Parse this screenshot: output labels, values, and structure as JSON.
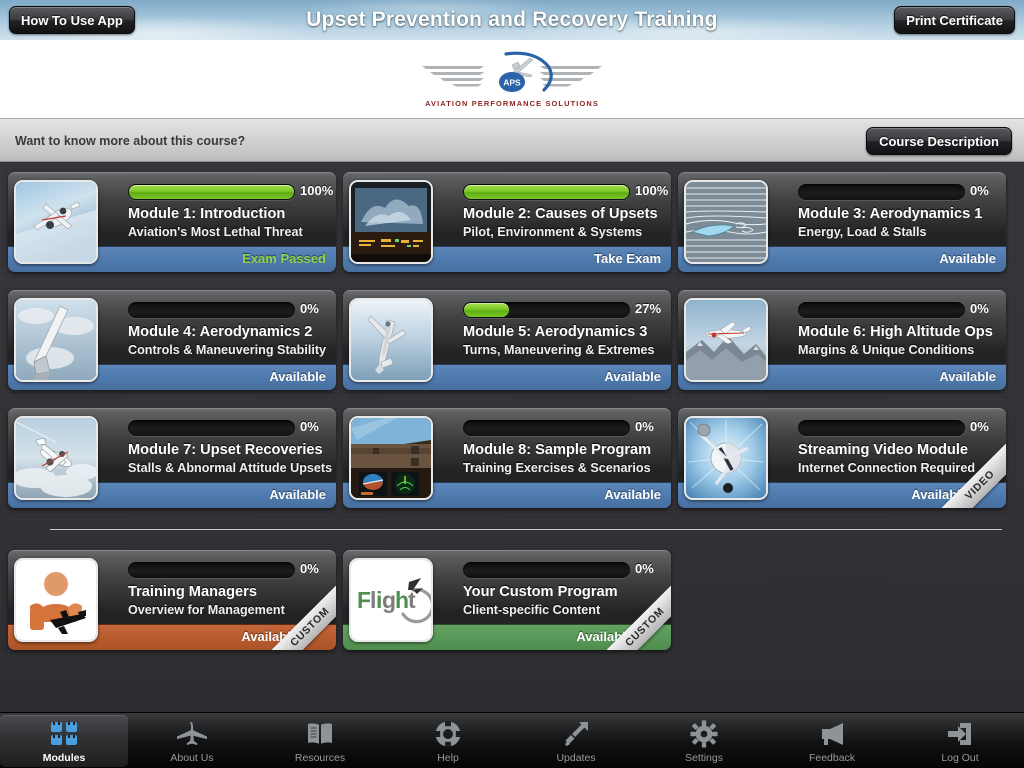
{
  "header": {
    "title": "Upset Prevention and Recovery Training",
    "how_to_button": "How To Use App",
    "print_button": "Print Certificate"
  },
  "logo": {
    "brand": "APS",
    "tagline": "AVIATION PERFORMANCE SOLUTIONS"
  },
  "course_bar": {
    "question": "Want to know more about this course?",
    "button": "Course Description"
  },
  "colors": {
    "progress_green": "#7cc72a",
    "footer_blue": "#4f7aae",
    "footer_orange": "#b85c2f",
    "footer_green": "#589858",
    "passed_text": "#8fd44a",
    "tagline_red": "#8e2420"
  },
  "modules": [
    {
      "title": "Module 1: Introduction",
      "subtitle": "Aviation's Most Lethal Threat",
      "percent_label": "100%",
      "percent": 100,
      "status": "Exam Passed",
      "status_style": "passed",
      "footer_style": "blue",
      "thumb": "airliner-descending-icon",
      "ribbon": null
    },
    {
      "title": "Module 2: Causes of Upsets",
      "subtitle": "Pilot, Environment & Systems",
      "percent_label": "100%",
      "percent": 100,
      "status": "Take Exam",
      "status_style": "normal",
      "footer_style": "blue",
      "thumb": "cockpit-storm-icon",
      "ribbon": null
    },
    {
      "title": "Module 3: Aerodynamics 1",
      "subtitle": "Energy, Load & Stalls",
      "percent_label": "0%",
      "percent": 0,
      "status": "Available",
      "status_style": "normal",
      "footer_style": "blue",
      "thumb": "airflow-wing-icon",
      "ribbon": null
    },
    {
      "title": "Module 4: Aerodynamics 2",
      "subtitle": "Controls & Maneuvering Stability",
      "percent_label": "0%",
      "percent": 0,
      "status": "Available",
      "status_style": "normal",
      "footer_style": "blue",
      "thumb": "winglet-sky-icon",
      "ribbon": null
    },
    {
      "title": "Module 5: Aerodynamics 3",
      "subtitle": "Turns, Maneuvering & Extremes",
      "percent_label": "27%",
      "percent": 27,
      "status": "Available",
      "status_style": "normal",
      "footer_style": "blue",
      "thumb": "aerobatic-plane-icon",
      "ribbon": null
    },
    {
      "title": "Module 6: High Altitude Ops",
      "subtitle": "Margins & Unique Conditions",
      "percent_label": "0%",
      "percent": 0,
      "status": "Available",
      "status_style": "normal",
      "footer_style": "blue",
      "thumb": "jet-over-mountains-icon",
      "ribbon": null
    },
    {
      "title": "Module 7: Upset Recoveries",
      "subtitle": "Stalls & Abnormal Attitude Upsets",
      "percent_label": "0%",
      "percent": 0,
      "status": "Available",
      "status_style": "normal",
      "footer_style": "blue",
      "thumb": "jet-banking-clouds-icon",
      "ribbon": null
    },
    {
      "title": "Module 8: Sample Program",
      "subtitle": "Training Exercises & Scenarios",
      "percent_label": "0%",
      "percent": 0,
      "status": "Available",
      "status_style": "normal",
      "footer_style": "blue",
      "thumb": "glass-cockpit-icon",
      "ribbon": null
    },
    {
      "title": "Streaming Video Module",
      "subtitle": "Internet Connection Required",
      "percent_label": "0%",
      "percent": 0,
      "status": "Available",
      "status_style": "normal",
      "footer_style": "blue",
      "thumb": "spinning-aircraft-icon",
      "ribbon": "VIDEO"
    }
  ],
  "custom_modules": [
    {
      "title": "Training Managers",
      "subtitle": "Overview for Management",
      "percent_label": "0%",
      "percent": 0,
      "status": "Available",
      "status_style": "normal",
      "footer_style": "orange",
      "thumb": "manager-person-plane-icon",
      "ribbon": "CUSTOM"
    },
    {
      "title": "Your Custom Program",
      "subtitle": "Client-specific Content",
      "percent_label": "0%",
      "percent": 0,
      "status": "Available",
      "status_style": "normal",
      "footer_style": "green",
      "thumb": "flight-logo-icon",
      "ribbon": "CUSTOM"
    }
  ],
  "tabs": [
    {
      "label": "Modules",
      "icon": "grid-icon",
      "active": true
    },
    {
      "label": "About Us",
      "icon": "airplane-icon",
      "active": false
    },
    {
      "label": "Resources",
      "icon": "book-icon",
      "active": false
    },
    {
      "label": "Help",
      "icon": "lifering-icon",
      "active": false
    },
    {
      "label": "Updates",
      "icon": "arrow-up-icon",
      "active": false
    },
    {
      "label": "Settings",
      "icon": "gear-icon",
      "active": false
    },
    {
      "label": "Feedback",
      "icon": "megaphone-icon",
      "active": false
    },
    {
      "label": "Log Out",
      "icon": "exit-icon",
      "active": false
    }
  ]
}
